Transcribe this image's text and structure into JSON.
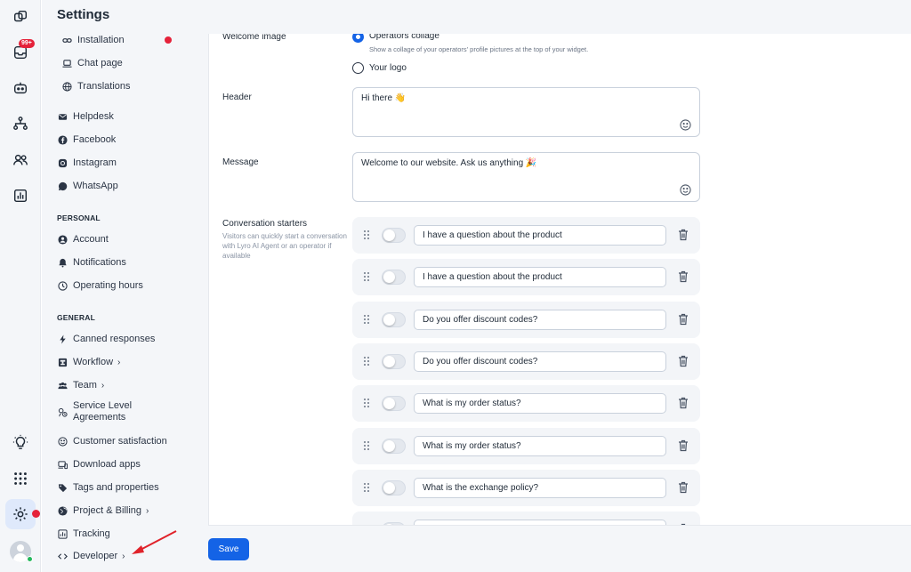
{
  "rail": {
    "inbox_badge": "99+"
  },
  "nav": {
    "title": "Settings",
    "channels": [
      {
        "label": "Installation",
        "icon": "link-icon"
      },
      {
        "label": "Chat page",
        "icon": "laptop-icon"
      },
      {
        "label": "Translations",
        "icon": "globe-icon"
      },
      {
        "label": "Helpdesk",
        "icon": "mail-icon"
      },
      {
        "label": "Facebook",
        "icon": "facebook-icon"
      },
      {
        "label": "Instagram",
        "icon": "instagram-icon"
      },
      {
        "label": "WhatsApp",
        "icon": "whatsapp-icon"
      }
    ],
    "personal_heading": "PERSONAL",
    "personal": [
      {
        "label": "Account"
      },
      {
        "label": "Notifications"
      },
      {
        "label": "Operating hours"
      }
    ],
    "general_heading": "GENERAL",
    "general": [
      {
        "label": "Canned responses"
      },
      {
        "label": "Workflow",
        "chevron": "›"
      },
      {
        "label": "Team",
        "chevron": "›"
      },
      {
        "label": "Service Level",
        "label2": "Agreements"
      },
      {
        "label": "Customer satisfaction"
      },
      {
        "label": "Download apps"
      },
      {
        "label": "Tags and properties"
      },
      {
        "label": "Project & Billing",
        "chevron": "›"
      },
      {
        "label": "Tracking"
      },
      {
        "label": "Developer",
        "chevron": "›"
      }
    ]
  },
  "form": {
    "welcome_image": {
      "label": "Welcome image",
      "options": [
        {
          "label": "Operators collage",
          "help": "Show a collage of your operators' profile pictures at the top of your widget.",
          "selected": true
        },
        {
          "label": "Your logo",
          "selected": false
        }
      ]
    },
    "header": {
      "label": "Header",
      "value": "Hi there 👋"
    },
    "message": {
      "label": "Message",
      "value": "Welcome to our website. Ask us anything 🎉"
    },
    "starters": {
      "label": "Conversation starters",
      "help": "Visitors can quickly start a conversation with Lyro AI Agent or an operator if available",
      "items": [
        "I have a question about the product",
        "I have a question about the product",
        "Do you offer discount codes?",
        "Do you offer discount codes?",
        "What is my order status?",
        "What is my order status?",
        "What is the exchange policy?",
        ""
      ]
    }
  },
  "save_label": "Save",
  "colors": {
    "accent": "#1463e6",
    "alert": "#e5223a",
    "online": "#22b85b",
    "annotation_arrow": "#e0222a"
  }
}
